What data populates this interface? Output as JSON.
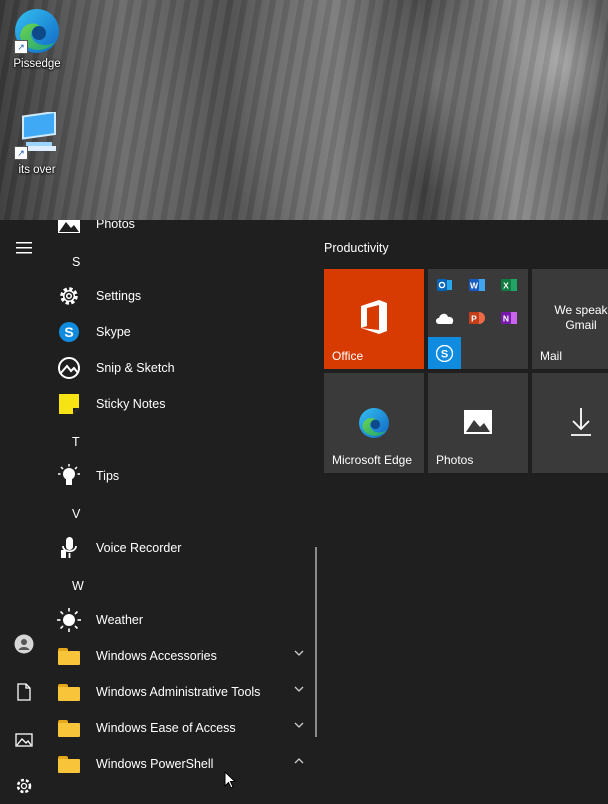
{
  "desktop": {
    "icons": [
      {
        "label": "Pissedge",
        "icon": "edge-icon"
      },
      {
        "label": "its over",
        "icon": "computer-icon"
      }
    ]
  },
  "start_menu": {
    "rail": {
      "menu_icon": "hamburger-icon",
      "user_icon": "user-icon",
      "documents_icon": "document-icon",
      "pictures_icon": "pictures-icon",
      "settings_icon": "gear-icon"
    },
    "app_list": [
      {
        "type": "app",
        "label": "Photos",
        "icon": "photos-icon"
      },
      {
        "type": "letter",
        "label": "S"
      },
      {
        "type": "app",
        "label": "Settings",
        "icon": "gear-icon"
      },
      {
        "type": "app",
        "label": "Skype",
        "icon": "skype-icon"
      },
      {
        "type": "app",
        "label": "Snip & Sketch",
        "icon": "snip-sketch-icon"
      },
      {
        "type": "app",
        "label": "Sticky Notes",
        "icon": "sticky-notes-icon"
      },
      {
        "type": "letter",
        "label": "T"
      },
      {
        "type": "app",
        "label": "Tips",
        "icon": "lightbulb-icon"
      },
      {
        "type": "letter",
        "label": "V"
      },
      {
        "type": "app",
        "label": "Voice Recorder",
        "icon": "microphone-icon"
      },
      {
        "type": "letter",
        "label": "W"
      },
      {
        "type": "app",
        "label": "Weather",
        "icon": "sun-icon"
      },
      {
        "type": "folder",
        "label": "Windows Accessories",
        "icon": "folder-icon",
        "expanded": false
      },
      {
        "type": "folder",
        "label": "Windows Administrative Tools",
        "icon": "folder-icon",
        "expanded": false
      },
      {
        "type": "folder",
        "label": "Windows Ease of Access",
        "icon": "folder-icon",
        "expanded": false
      },
      {
        "type": "folder",
        "label": "Windows PowerShell",
        "icon": "folder-icon",
        "expanded": true
      }
    ],
    "tiles": {
      "group_title": "Productivity",
      "office": {
        "label": "Office",
        "color": "#d83b01"
      },
      "office_apps": [
        "outlook-icon",
        "word-icon",
        "excel-icon",
        "onedrive-icon",
        "powerpoint-icon",
        "onenote-icon",
        "skype-icon"
      ],
      "mail": {
        "label": "Mail",
        "text": "We speak Gmail"
      },
      "edge": {
        "label": "Microsoft Edge"
      },
      "photos": {
        "label": "Photos"
      },
      "download": {
        "icon": "download-icon"
      }
    }
  }
}
